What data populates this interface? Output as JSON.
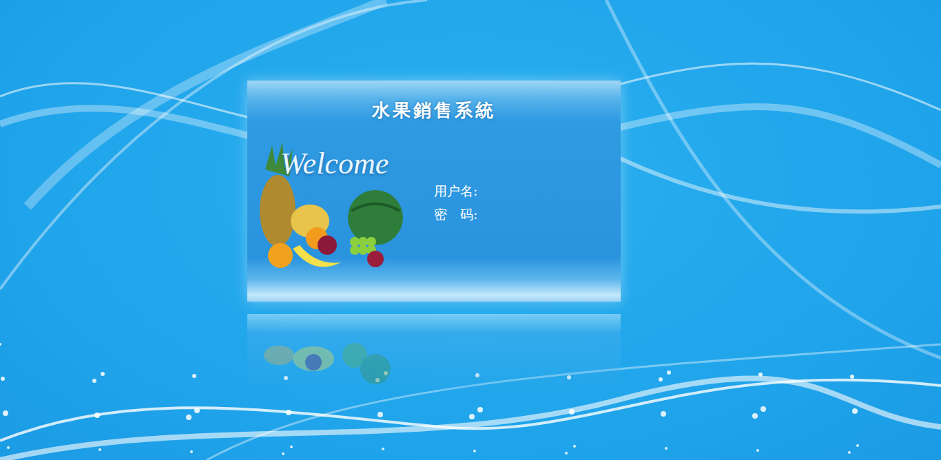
{
  "window": {
    "title": "水果銷售系統"
  },
  "banner": {
    "text": "Welcome"
  },
  "form": {
    "fields": [
      {
        "label": "用户名:",
        "value": "",
        "kind": "text"
      },
      {
        "label": "密　码:",
        "value": "",
        "kind": "password"
      }
    ]
  }
}
